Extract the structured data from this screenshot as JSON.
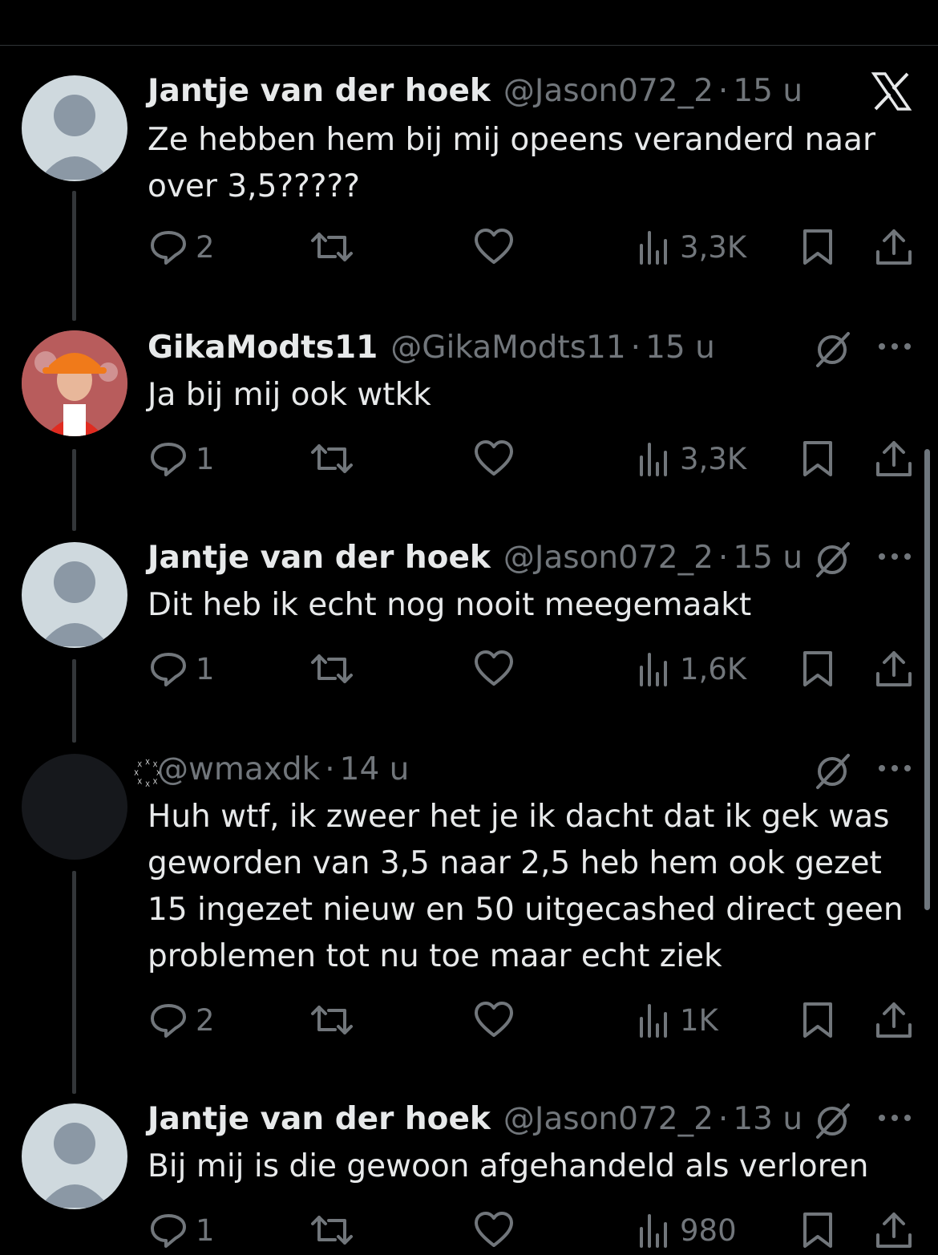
{
  "close_icon": "x-logo",
  "tweets": [
    {
      "name": "Jantje van der hoek",
      "handle": "@Jason072_2",
      "sep": "·",
      "time": "15 u",
      "text": "Ze hebben hem bij mij opeens veranderd naar over 3,5?????",
      "replies": "2",
      "views": "3,3K"
    },
    {
      "name": "GikaModts11",
      "handle": "@GikaModts11",
      "sep": "·",
      "time": "15 u",
      "text": "Ja bij mij ook wtkk",
      "replies": "1",
      "views": "3,3K"
    },
    {
      "name": "Jantje van der hoek",
      "handle": "@Jason072_2",
      "sep": "·",
      "time": "15 u",
      "text": "Dit heb ik echt nog nooit meegemaakt",
      "replies": "1",
      "views": "1,6K"
    },
    {
      "name": "꙰",
      "handle": "@wmaxdk",
      "sep": "·",
      "time": "14 u",
      "text": "Huh wtf, ik zweer het je ik dacht dat ik gek was geworden van 3,5 naar 2,5 heb hem ook gezet 15 ingezet nieuw en 50 uitgecashed direct geen problemen tot nu toe maar echt ziek",
      "replies": "2",
      "views": "1K"
    },
    {
      "name": "Jantje van der hoek",
      "handle": "@Jason072_2",
      "sep": "·",
      "time": "13 u",
      "text": "Bij mij is die gewoon afgehandeld als verloren",
      "replies": "1",
      "views": "980"
    }
  ]
}
